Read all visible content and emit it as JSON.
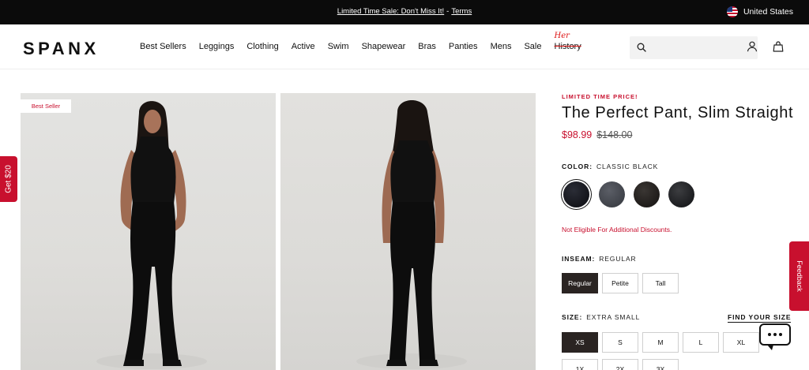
{
  "promo_bar": {
    "sale_link": "Limited Time Sale: Don't Miss It!",
    "separator": "-",
    "terms_link": "Terms",
    "region": "United States"
  },
  "header": {
    "logo": "SPANX",
    "nav": [
      "Best Sellers",
      "Leggings",
      "Clothing",
      "Active",
      "Swim",
      "Shapewear",
      "Bras",
      "Panties",
      "Mens",
      "Sale"
    ],
    "history": {
      "overlay": "Her",
      "label": "History"
    },
    "search_placeholder": ""
  },
  "gallery": {
    "badge": "Best Seller",
    "images": [
      "front-view-model",
      "back-view-model"
    ]
  },
  "side_tabs": {
    "get": "Get $20",
    "feedback": "Feedback"
  },
  "product": {
    "promo_label": "LIMITED TIME PRICE!",
    "title": "The Perfect Pant, Slim Straight",
    "sale_price": "$98.99",
    "original_price": "$148.00",
    "color_label": "COLOR:",
    "color_value": "CLASSIC BLACK",
    "swatches": [
      {
        "name": "Classic Black",
        "hex": "#14151b"
      },
      {
        "name": "Grey",
        "hex": "#4a4d54"
      },
      {
        "name": "Brown",
        "hex": "#2a2624"
      },
      {
        "name": "Black Dot",
        "hex": "#242528"
      }
    ],
    "not_eligible": "Not Eligible For Additional Discounts.",
    "inseam_label": "INSEAM:",
    "inseam_value": "REGULAR",
    "inseams": [
      "Regular",
      "Petite",
      "Tall"
    ],
    "size_label": "SIZE:",
    "size_value": "EXTRA SMALL",
    "find_size": "FIND YOUR SIZE",
    "sizes": [
      "XS",
      "S",
      "M",
      "L",
      "XL",
      "1X",
      "2X",
      "3X"
    ]
  },
  "colors": {
    "accent": "#c8102e",
    "selected": "#2a2422",
    "promo_bg": "#0b0b0b"
  }
}
